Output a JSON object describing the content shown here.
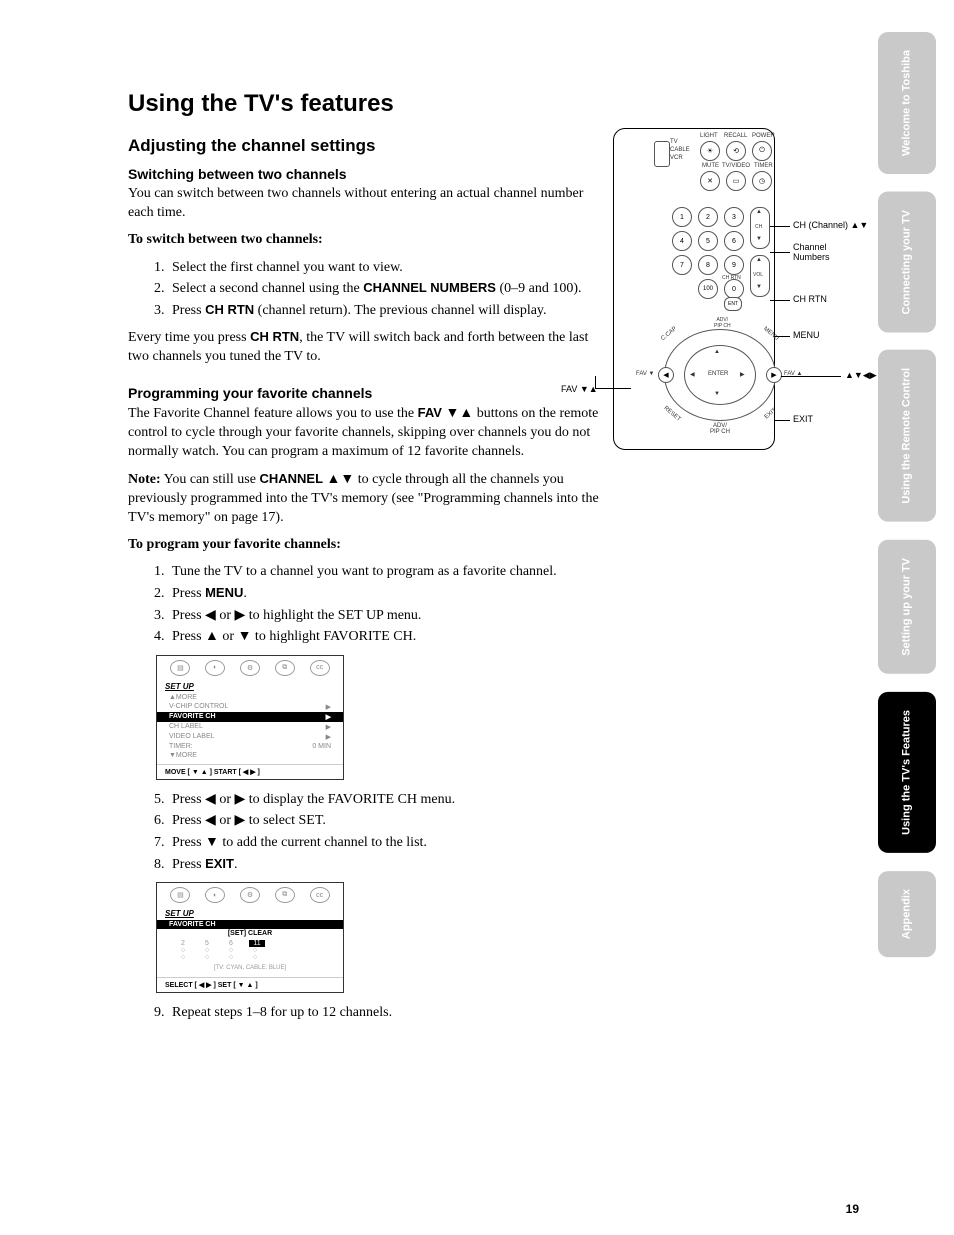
{
  "page_number": "19",
  "title": "Using the TV's features",
  "h2": "Adjusting the channel settings",
  "switching": {
    "heading": "Switching between two channels",
    "intro": "You can switch between two channels without entering an actual channel number each time.",
    "list_label": "To switch between two channels:",
    "s1": "Select the first channel you want to view.",
    "s2a": "Select a second channel using the ",
    "s2b_bold": "CHANNEL NUMBERS",
    "s2c": " (0–9 and 100).",
    "s3a": "Press ",
    "s3b_bold": "CH RTN",
    "s3c": " (channel return). The previous channel will display.",
    "outro_a": "Every time you press ",
    "outro_bold": "CH RTN",
    "outro_b": ", the TV will switch back and forth between the last two channels you tuned the TV to."
  },
  "favorites": {
    "heading": "Programming your favorite channels",
    "p1a": "The Favorite Channel feature allows you to use the ",
    "p1_bold": "FAV",
    "p1_sym": " ▼▲",
    "p1b": " buttons on the remote control to cycle through your favorite channels, skipping over channels you do not normally watch. You can program a maximum of 12 favorite channels.",
    "note_label": "Note:",
    "note_a": " You can still use ",
    "note_bold": "CHANNEL",
    "note_sym": " ▲▼",
    "note_b": " to cycle through all the channels you previously programmed into the TV's memory (see \"Programming channels into the TV's memory\" on page 17).",
    "list_label": "To program your favorite channels:",
    "s1": "Tune the TV to a channel you want to program as a favorite channel.",
    "s2a": "Press ",
    "s2_bold": "MENU",
    "s2b": ".",
    "s3": "Press ◀ or ▶ to highlight the SET UP menu.",
    "s4": "Press ▲ or ▼ to highlight FAVORITE CH.",
    "s5": "Press ◀ or ▶ to display the FAVORITE CH menu.",
    "s6": "Press ◀ or ▶ to select SET.",
    "s7": "Press ▼ to add the current channel to the list.",
    "s8a": "Press ",
    "s8_bold": "EXIT",
    "s8b": ".",
    "s9": "Repeat steps 1–8 for up to 12 channels."
  },
  "osd1": {
    "title": "SET UP",
    "rows": [
      {
        "l": "▲MORE",
        "r": ""
      },
      {
        "l": "V-CHIP CONTROL",
        "r": "▶"
      },
      {
        "l": "FAVORITE CH",
        "r": "▶",
        "hi": true
      },
      {
        "l": "CH LABEL",
        "r": "▶"
      },
      {
        "l": "VIDEO LABEL",
        "r": "▶"
      },
      {
        "l": "TIMER:",
        "r": "0 MIN"
      },
      {
        "l": "▼MORE",
        "r": ""
      }
    ],
    "bottom": "MOVE [ ▼ ▲ ]    START [ ◀  ▶ ]"
  },
  "osd2": {
    "title": "SET UP",
    "hi_row": "FAVORITE CH",
    "setclear": "[SET]  CLEAR",
    "grid": [
      [
        "2",
        "5",
        "6",
        "11"
      ],
      [
        "○",
        "○",
        "○",
        "○"
      ],
      [
        "○",
        "○",
        "○",
        "○"
      ]
    ],
    "note": "[TV: CYAN,   CABLE: BLUE]",
    "bottom": "SELECT [ ◀  ▶ ]    SET [ ▼ ▲ ]"
  },
  "remote": {
    "top_row1": [
      "LIGHT",
      "RECALL",
      "POWER"
    ],
    "top_row2": [
      "MUTE",
      "TV/VIDEO",
      "TIMER"
    ],
    "side_switch": [
      "TV",
      "CABLE",
      "VCR"
    ],
    "numbers": [
      "1",
      "2",
      "3",
      "4",
      "5",
      "6",
      "7",
      "8",
      "9",
      "100",
      "0"
    ],
    "ch_label": "CH",
    "vol_label": "VOL",
    "chrtn": "CH RTN",
    "adv_pip": "ADV/\nPIP CH",
    "ccap": "C.CAP",
    "menu": "MENU",
    "reset": "RESET",
    "exit": "EXIT",
    "fav_l": "FAV ▼",
    "fav_r": "FAV ▲",
    "enter": "ENTER",
    "ent": "ENT",
    "callouts": {
      "ch": "CH (Channel) ▲▼",
      "nums": "Channel\nNumbers",
      "chrtn": "CH RTN",
      "menu": "MENU",
      "arrows": "▲▼◀▶",
      "exit": "EXIT",
      "fav": "FAV ▼▲"
    }
  },
  "tabs": [
    {
      "label": "Welcome to\nToshiba",
      "active": false
    },
    {
      "label": "Connecting\nyour TV",
      "active": false
    },
    {
      "label": "Using the\nRemote Control",
      "active": false
    },
    {
      "label": "Setting up\nyour TV",
      "active": false
    },
    {
      "label": "Using the TV's\nFeatures",
      "active": true
    },
    {
      "label": "Appendix",
      "active": false
    }
  ]
}
